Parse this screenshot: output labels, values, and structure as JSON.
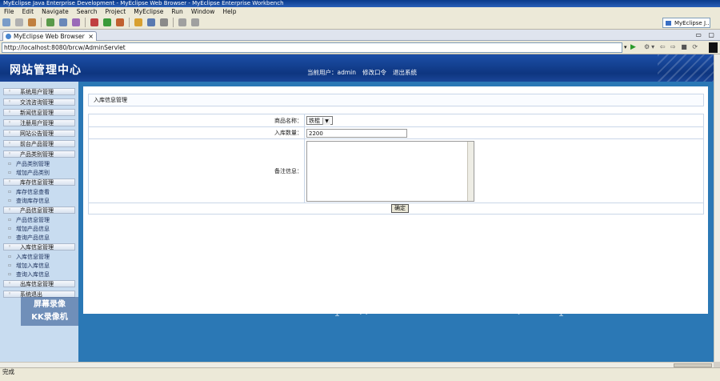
{
  "window": {
    "title": "MyEclipse Java Enterprise Development - MyEclipse Web Browser - MyEclipse Enterprise Workbench"
  },
  "menu": [
    "File",
    "Edit",
    "Navigate",
    "Search",
    "Project",
    "MyEclipse",
    "Run",
    "Window",
    "Help"
  ],
  "perspective": {
    "label": "MyEclipse J..."
  },
  "editor_tab": {
    "label": "MyEclipse Web Browser"
  },
  "address": {
    "url": "http://localhost:8080/brcw/AdminServlet"
  },
  "site": {
    "title": "网站管理中心",
    "current_user_label": "当前用户：admin",
    "change_password": "修改口令",
    "logout": "退出系统"
  },
  "sidebar": {
    "groups": [
      {
        "label": "系统用户管理",
        "items": []
      },
      {
        "label": "交流咨询管理",
        "items": []
      },
      {
        "label": "新闻信息管理",
        "items": []
      },
      {
        "label": "注册用户管理",
        "items": []
      },
      {
        "label": "网站公告管理",
        "items": []
      },
      {
        "label": "前台产品管理",
        "items": []
      },
      {
        "label": "产品类别管理",
        "items": [
          "产品类别管理",
          "增加产品类别"
        ]
      },
      {
        "label": "库存信息管理",
        "items": [
          "库存信息查看",
          "查询库存信息"
        ]
      },
      {
        "label": "产品信息管理",
        "items": [
          "产品信息管理",
          "增加产品信息",
          "查询产品信息"
        ]
      },
      {
        "label": "入库信息管理",
        "items": [
          "入库信息管理",
          "增加入库信息",
          "查询入库信息"
        ]
      },
      {
        "label": "出库信息管理",
        "items": []
      },
      {
        "label": "系统退出",
        "items": []
      }
    ]
  },
  "panel": {
    "title": "入库信息管理",
    "product_label": "商品名称：",
    "product_value": "铁棍",
    "qty_label": "入库数量：",
    "qty_value": "2200",
    "note_label": "备注信息：",
    "note_value": "",
    "submit_label": "确定"
  },
  "watermark": {
    "url": "https://www.huzhan.com/ishop30884",
    "stamp_line1": "屏幕录像",
    "stamp_line2": "KK录像机"
  },
  "status": {
    "text": "完成"
  }
}
